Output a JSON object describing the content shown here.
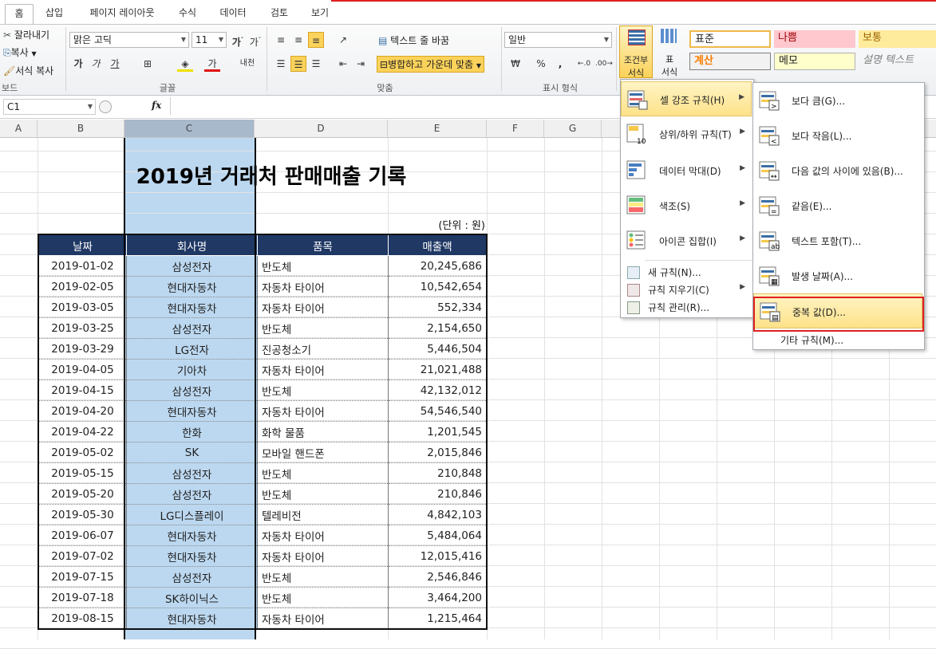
{
  "tabs": [
    "홈",
    "삽입",
    "페이지 레이아웃",
    "수식",
    "데이터",
    "검토",
    "보기"
  ],
  "clipboard": {
    "cut": "잘라내기",
    "copy": "복사",
    "format_painter": "서식 복사",
    "group": "보드"
  },
  "font": {
    "name": "맑은 고딕",
    "size": "11",
    "group": "글꼴",
    "bold": "가",
    "italic": "가",
    "underline": "가",
    "color_a": "가",
    "pinyin": "내천"
  },
  "alignment": {
    "wrap": "텍스트 줄 바꿈",
    "merge": "병합하고 가운데 맞춤",
    "group": "맞춤"
  },
  "number": {
    "format": "일반",
    "percent": "%",
    "comma": ",",
    "group": "표시 형식"
  },
  "styles": {
    "conditional": "조건부",
    "conditional2": "서식",
    "table": "표",
    "table2": "서식",
    "normal": "표준",
    "bad": "나쁨",
    "neutral": "보통",
    "calc": "계산",
    "memo": "메모",
    "explain": "설명 텍스트"
  },
  "formula_bar": {
    "cell_ref": "C1",
    "fx": "fx",
    "value": ""
  },
  "columns": [
    "A",
    "B",
    "C",
    "D",
    "E",
    "F",
    "G"
  ],
  "sheet": {
    "title": "2019년 거래처 판매매출 기록",
    "unit": "(단위 : 원)",
    "headers": [
      "날짜",
      "회사명",
      "품목",
      "매출액"
    ],
    "rows": [
      [
        "2019-01-02",
        "삼성전자",
        "반도체",
        "20,245,686"
      ],
      [
        "2019-02-05",
        "현대자동차",
        "자동차 타이어",
        "10,542,654"
      ],
      [
        "2019-03-05",
        "현대자동차",
        "자동차 타이어",
        "552,334"
      ],
      [
        "2019-03-25",
        "삼성전자",
        "반도체",
        "2,154,650"
      ],
      [
        "2019-03-29",
        "LG전자",
        "진공청소기",
        "5,446,504"
      ],
      [
        "2019-04-05",
        "기아차",
        "자동차 타이어",
        "21,021,488"
      ],
      [
        "2019-04-15",
        "삼성전자",
        "반도체",
        "42,132,012"
      ],
      [
        "2019-04-20",
        "현대자동차",
        "자동차 타이어",
        "54,546,540"
      ],
      [
        "2019-04-22",
        "한화",
        "화학 물품",
        "1,201,545"
      ],
      [
        "2019-05-02",
        "SK",
        "모바일 핸드폰",
        "2,015,846"
      ],
      [
        "2019-05-15",
        "삼성전자",
        "반도체",
        "210,848"
      ],
      [
        "2019-05-20",
        "삼성전자",
        "반도체",
        "210,846"
      ],
      [
        "2019-05-30",
        "LG디스플레이",
        "텔레비전",
        "4,842,103"
      ],
      [
        "2019-06-07",
        "현대자동차",
        "자동차 타이어",
        "5,484,064"
      ],
      [
        "2019-07-02",
        "현대자동차",
        "자동차 타이어",
        "12,015,416"
      ],
      [
        "2019-07-15",
        "삼성전자",
        "반도체",
        "2,546,846"
      ],
      [
        "2019-07-18",
        "SK하이닉스",
        "반도체",
        "3,464,200"
      ],
      [
        "2019-08-15",
        "현대자동차",
        "자동차 타이어",
        "1,215,464"
      ]
    ]
  },
  "cf_menu": {
    "items": [
      "셀 강조 규칙(H)",
      "상위/하위 규칙(T)",
      "데이터 막대(D)",
      "색조(S)",
      "아이콘 집합(I)"
    ],
    "small": [
      "새 규칙(N)...",
      "규칙 지우기(C)",
      "규칙 관리(R)..."
    ]
  },
  "sub_menu": {
    "items": [
      "보다 큼(G)...",
      "보다 작음(L)...",
      "다음 값의 사이에 있음(B)...",
      "같음(E)...",
      "텍스트 포함(T)...",
      "발생 날짜(A)...",
      "중복 값(D)..."
    ],
    "more": "기타 규칙(M)..."
  },
  "colors": {
    "header_fill": "#1f3864",
    "selection": "#bcd8f0",
    "highlight_border": "#e02020",
    "menu_hot": "#fde28a"
  }
}
